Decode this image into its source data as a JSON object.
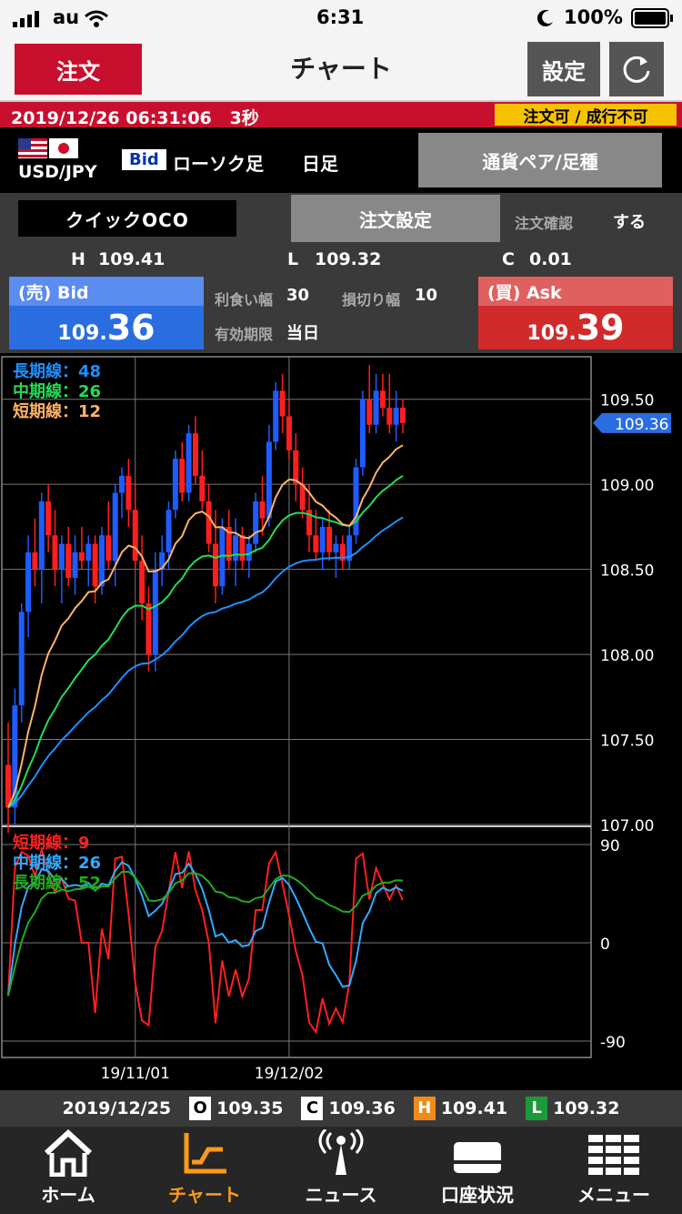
{
  "status_bar": {
    "carrier": "au",
    "time": "6:31",
    "battery": "100%"
  },
  "header": {
    "order_button": "注文",
    "title": "チャート",
    "settings_button": "設定",
    "refresh_icon": "refresh-icon"
  },
  "datetime_bar": {
    "datetime": "2019/12/26 06:31:06",
    "interval": "3秒",
    "status": "注文可 / 成行不可"
  },
  "pair_row": {
    "pair": "USD/JPY",
    "price_type": "Bid",
    "chart_type": "ローソク足",
    "period": "日足",
    "pair_button": "通貨ペア/足種"
  },
  "order_row": {
    "quick_oco": "クイックOCO",
    "order_settings": "注文設定",
    "order_confirm_label": "注文確認",
    "order_confirm_value": "する",
    "high_label": "H",
    "high_value": "109.41",
    "low_label": "L",
    "low_value": "109.32",
    "change_label": "C",
    "change_value": "0.01",
    "take_profit_label": "利食い幅",
    "take_profit_value": "30",
    "stop_loss_label": "損切り幅",
    "stop_loss_value": "10",
    "expiry_label": "有効期限",
    "expiry_value": "当日",
    "sell": {
      "label": "(売)  Bid",
      "price_small": "109.",
      "price_big": "36"
    },
    "buy": {
      "label": "(買)  Ask",
      "price_small": "109.",
      "price_big": "39"
    }
  },
  "chart_data": [
    {
      "type": "candlestick",
      "legend": [
        {
          "label": "長期線：48",
          "color": "#1e90ff"
        },
        {
          "label": "中期線：26",
          "color": "#22dd55"
        },
        {
          "label": "短期線：12",
          "color": "#ffb366"
        }
      ],
      "ylim": [
        107.0,
        109.75
      ],
      "y_ticks": [
        "109.50",
        "109.00",
        "108.50",
        "108.00",
        "107.50",
        "107.00"
      ],
      "current_price": "109.36",
      "x_ticks": [
        "19/11/01",
        "19/12/02"
      ],
      "candles": [
        [
          107.35,
          107.6,
          106.95,
          107.1
        ],
        [
          107.1,
          107.8,
          107.0,
          107.7
        ],
        [
          107.7,
          108.3,
          107.6,
          108.25
        ],
        [
          108.25,
          108.7,
          108.1,
          108.6
        ],
        [
          108.6,
          108.8,
          108.4,
          108.5
        ],
        [
          108.5,
          108.95,
          108.3,
          108.9
        ],
        [
          108.9,
          109.0,
          108.6,
          108.7
        ],
        [
          108.7,
          108.85,
          108.4,
          108.5
        ],
        [
          108.5,
          108.7,
          108.3,
          108.65
        ],
        [
          108.65,
          108.75,
          108.4,
          108.45
        ],
        [
          108.45,
          108.7,
          108.35,
          108.6
        ],
        [
          108.6,
          108.75,
          108.5,
          108.55
        ],
        [
          108.55,
          108.7,
          108.4,
          108.65
        ],
        [
          108.65,
          108.7,
          108.3,
          108.4
        ],
        [
          108.4,
          108.75,
          108.35,
          108.7
        ],
        [
          108.7,
          108.9,
          108.5,
          108.55
        ],
        [
          108.55,
          109.0,
          108.4,
          108.95
        ],
        [
          108.95,
          109.1,
          108.8,
          109.05
        ],
        [
          109.05,
          109.15,
          108.75,
          108.85
        ],
        [
          108.85,
          109.0,
          108.5,
          108.55
        ],
        [
          108.55,
          108.7,
          108.2,
          108.3
        ],
        [
          108.3,
          108.4,
          107.9,
          108.0
        ],
        [
          108.0,
          108.6,
          107.9,
          108.5
        ],
        [
          108.5,
          108.7,
          108.4,
          108.6
        ],
        [
          108.6,
          108.9,
          108.5,
          108.85
        ],
        [
          108.85,
          109.2,
          108.8,
          109.15
        ],
        [
          109.15,
          109.25,
          108.9,
          108.95
        ],
        [
          108.95,
          109.35,
          108.9,
          109.3
        ],
        [
          109.3,
          109.4,
          109.0,
          109.05
        ],
        [
          109.05,
          109.2,
          108.85,
          108.9
        ],
        [
          108.9,
          109.0,
          108.6,
          108.65
        ],
        [
          108.65,
          108.85,
          108.3,
          108.4
        ],
        [
          108.4,
          108.8,
          108.35,
          108.75
        ],
        [
          108.75,
          108.85,
          108.5,
          108.55
        ],
        [
          108.55,
          108.8,
          108.4,
          108.7
        ],
        [
          108.7,
          108.75,
          108.5,
          108.55
        ],
        [
          108.55,
          108.7,
          108.45,
          108.65
        ],
        [
          108.65,
          108.95,
          108.6,
          108.9
        ],
        [
          108.9,
          109.05,
          108.7,
          108.8
        ],
        [
          108.8,
          109.35,
          108.75,
          109.25
        ],
        [
          109.25,
          109.6,
          109.2,
          109.55
        ],
        [
          109.55,
          109.65,
          109.3,
          109.4
        ],
        [
          109.4,
          109.5,
          109.15,
          109.2
        ],
        [
          109.2,
          109.3,
          108.9,
          109.0
        ],
        [
          109.0,
          109.1,
          108.8,
          108.85
        ],
        [
          108.85,
          109.0,
          108.6,
          108.7
        ],
        [
          108.7,
          108.85,
          108.55,
          108.6
        ],
        [
          108.6,
          108.8,
          108.5,
          108.75
        ],
        [
          108.75,
          108.85,
          108.55,
          108.6
        ],
        [
          108.6,
          108.7,
          108.45,
          108.65
        ],
        [
          108.65,
          108.7,
          108.5,
          108.55
        ],
        [
          108.55,
          108.75,
          108.5,
          108.7
        ],
        [
          108.7,
          109.15,
          108.65,
          109.1
        ],
        [
          109.1,
          109.55,
          109.05,
          109.5
        ],
        [
          109.5,
          109.7,
          109.3,
          109.35
        ],
        [
          109.35,
          109.65,
          109.3,
          109.55
        ],
        [
          109.55,
          109.65,
          109.4,
          109.45
        ],
        [
          109.45,
          109.65,
          109.3,
          109.35
        ],
        [
          109.35,
          109.55,
          109.25,
          109.45
        ],
        [
          109.45,
          109.5,
          109.3,
          109.36
        ]
      ]
    },
    {
      "type": "line",
      "legend": [
        {
          "label": "短期線：9",
          "color": "#ff2020"
        },
        {
          "label": "中期線：26",
          "color": "#33aaff"
        },
        {
          "label": "長期線：52",
          "color": "#22aa22"
        }
      ],
      "ylim": [
        -90,
        90
      ],
      "y_ticks": [
        "90",
        "0",
        "-90"
      ]
    }
  ],
  "ohlc_bar": {
    "date": "2019/12/25",
    "open_label": "O",
    "open_value": "109.35",
    "close_label": "C",
    "close_value": "109.36",
    "high_label": "H",
    "high_value": "109.41",
    "low_label": "L",
    "low_value": "109.32"
  },
  "bottom_nav": [
    {
      "label": "ホーム",
      "icon": "home-icon",
      "active": false
    },
    {
      "label": "チャート",
      "icon": "chart-icon",
      "active": true
    },
    {
      "label": "ニュース",
      "icon": "news-icon",
      "active": false
    },
    {
      "label": "口座状況",
      "icon": "account-icon",
      "active": false
    },
    {
      "label": "メニュー",
      "icon": "menu-icon",
      "active": false
    }
  ],
  "colors": {
    "brand_red": "#c8102e",
    "status_yellow": "#f6c200",
    "bid_blue": "#2a6de0",
    "ask_red": "#d02a2a",
    "active_nav": "#ff9a1a"
  }
}
